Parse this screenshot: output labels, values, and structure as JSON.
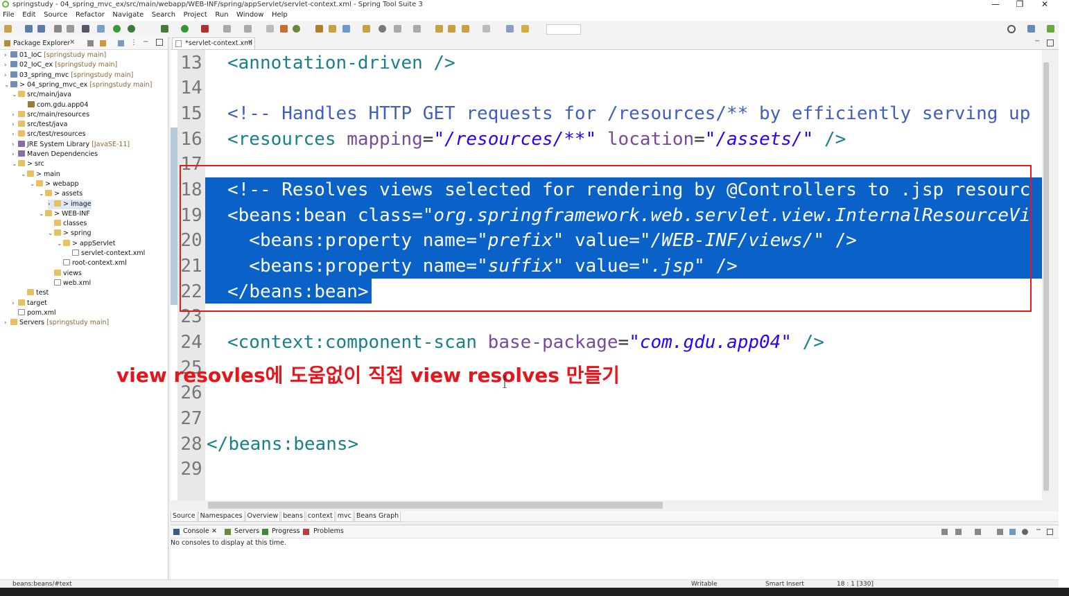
{
  "window": {
    "title": "springstudy - 04_spring_mvc_ex/src/main/webapp/WEB-INF/spring/appServlet/servlet-context.xml - Spring Tool Suite 3",
    "minimize": "—",
    "restore": "❐",
    "close": "✕"
  },
  "menu": [
    "File",
    "Edit",
    "Source",
    "Refactor",
    "Navigate",
    "Search",
    "Project",
    "Run",
    "Window",
    "Help"
  ],
  "package_explorer": {
    "title": "Package Explorer",
    "close": "✕",
    "items": [
      {
        "arrow": "›",
        "name": "01_IoC",
        "decor": " [springstudy main]",
        "icon": "proj"
      },
      {
        "arrow": "›",
        "name": "02_IoC_ex",
        "decor": " [springstudy main]",
        "icon": "proj"
      },
      {
        "arrow": "›",
        "name": "03_spring_mvc",
        "decor": " [springstudy main]",
        "icon": "proj"
      },
      {
        "arrow": "⌄",
        "name": "> 04_spring_mvc_ex",
        "decor": " [springstudy main]",
        "icon": "proj"
      },
      {
        "arrow": "⌄",
        "name": "src/main/java",
        "decor": "",
        "icon": "folder"
      },
      {
        "arrow": "",
        "name": "com.gdu.app04",
        "decor": "",
        "icon": "pkg"
      },
      {
        "arrow": "›",
        "name": "src/main/resources",
        "decor": "",
        "icon": "folder"
      },
      {
        "arrow": "›",
        "name": "src/test/java",
        "decor": "",
        "icon": "folder"
      },
      {
        "arrow": "›",
        "name": "src/test/resources",
        "decor": "",
        "icon": "folder"
      },
      {
        "arrow": "›",
        "name": "JRE System Library",
        "decor": " [JavaSE-11]",
        "icon": "lib"
      },
      {
        "arrow": "›",
        "name": "Maven Dependencies",
        "decor": "",
        "icon": "lib"
      },
      {
        "arrow": "⌄",
        "name": "> src",
        "decor": "",
        "icon": "folder"
      },
      {
        "arrow": "⌄",
        "name": "> main",
        "decor": "",
        "icon": "folder"
      },
      {
        "arrow": "⌄",
        "name": "> webapp",
        "decor": "",
        "icon": "folder"
      },
      {
        "arrow": "⌄",
        "name": "> assets",
        "decor": "",
        "icon": "folder"
      },
      {
        "arrow": "›",
        "name": "> image",
        "decor": "",
        "icon": "folder"
      },
      {
        "arrow": "⌄",
        "name": "> WEB-INF",
        "decor": "",
        "icon": "folder"
      },
      {
        "arrow": "",
        "name": "classes",
        "decor": "",
        "icon": "folder"
      },
      {
        "arrow": "⌄",
        "name": "> spring",
        "decor": "",
        "icon": "folder"
      },
      {
        "arrow": "⌄",
        "name": "> appServlet",
        "decor": "",
        "icon": "folder"
      },
      {
        "arrow": "",
        "name": "servlet-context.xml",
        "decor": "",
        "icon": "xml"
      },
      {
        "arrow": "",
        "name": "root-context.xml",
        "decor": "",
        "icon": "xml"
      },
      {
        "arrow": "",
        "name": "views",
        "decor": "",
        "icon": "folder"
      },
      {
        "arrow": "",
        "name": "web.xml",
        "decor": "",
        "icon": "xml"
      },
      {
        "arrow": "",
        "name": "test",
        "decor": "",
        "icon": "folder"
      },
      {
        "arrow": "›",
        "name": "target",
        "decor": "",
        "icon": "folder"
      },
      {
        "arrow": "",
        "name": "pom.xml",
        "decor": "",
        "icon": "xml"
      },
      {
        "arrow": "›",
        "name": "Servers",
        "decor": " [springstudy main]",
        "icon": "folder"
      }
    ]
  },
  "editor": {
    "tab_label": "*servlet-context.xml",
    "tab_close": "✕",
    "line_numbers": [
      "13",
      "14",
      "15",
      "16",
      "17",
      "18",
      "19",
      "20",
      "21",
      "22",
      "23",
      "24",
      "25",
      "26",
      "27",
      "28",
      "29"
    ],
    "code": {
      "l13": {
        "open": "<",
        "tag": "annotation-driven",
        "close": " />"
      },
      "l15": {
        "comment": "<!-- Handles HTTP GET requests for /resources/** by efficiently serving up"
      },
      "l16": {
        "open": "<",
        "tag": "resources",
        "a1": " mapping",
        "eq1": "=",
        "v1": "\"/resources/**\"",
        "a2": " location",
        "eq2": "=",
        "v2": "\"/assets/\"",
        "close": " />"
      },
      "l18": {
        "comment": "<!-- Resolves views selected for rendering by @Controllers to .jsp resourc"
      },
      "l19": {
        "open": "<",
        "tag": "beans:bean",
        "a1": " class",
        "eq1": "=",
        "v1": "\"org.springframework.web.servlet.view.InternalResourceVi"
      },
      "l20": {
        "open": "  <",
        "tag": "beans:property",
        "a1": " name",
        "eq1": "=",
        "v1": "\"prefix\"",
        "a2": " value",
        "eq2": "=",
        "v2": "\"/WEB-INF/views/\"",
        "close": " />"
      },
      "l21": {
        "open": "  <",
        "tag": "beans:property",
        "a1": " name",
        "eq1": "=",
        "v1": "\"suffix\"",
        "a2": " value",
        "eq2": "=",
        "v2": "\".jsp\"",
        "close": " />"
      },
      "l22": {
        "open": "</",
        "tag": "beans:bean",
        "close": ">"
      },
      "l24": {
        "open": "<",
        "tag": "context:component-scan",
        "a1": " base-package",
        "eq1": "=",
        "v1": "\"com.gdu.app04\"",
        "close": " />"
      },
      "l28": {
        "open": "</",
        "tag": "beans:beans",
        "close": ">"
      }
    }
  },
  "annotation": "view resovles에 도움없이 직접 view resolves 만들기",
  "editor_bottom_tabs": [
    "Source",
    "Namespaces",
    "Overview",
    "beans",
    "context",
    "mvc",
    "Beans Graph"
  ],
  "console": {
    "tabs": [
      "Console",
      "Servers",
      "Progress",
      "Problems"
    ],
    "close": "✕",
    "message": "No consoles to display at this time."
  },
  "status": {
    "left": "beans:beans/#text",
    "mode": "Writable",
    "insert": "Smart Insert",
    "position": "18 : 1 [330]"
  },
  "colors": {
    "selection": "#0a62c9",
    "annotation": "#e8141c",
    "tag": "#17808b",
    "attribute": "#7a4a9a",
    "value": "#2a00ff",
    "comment": "#3f5fbf"
  }
}
